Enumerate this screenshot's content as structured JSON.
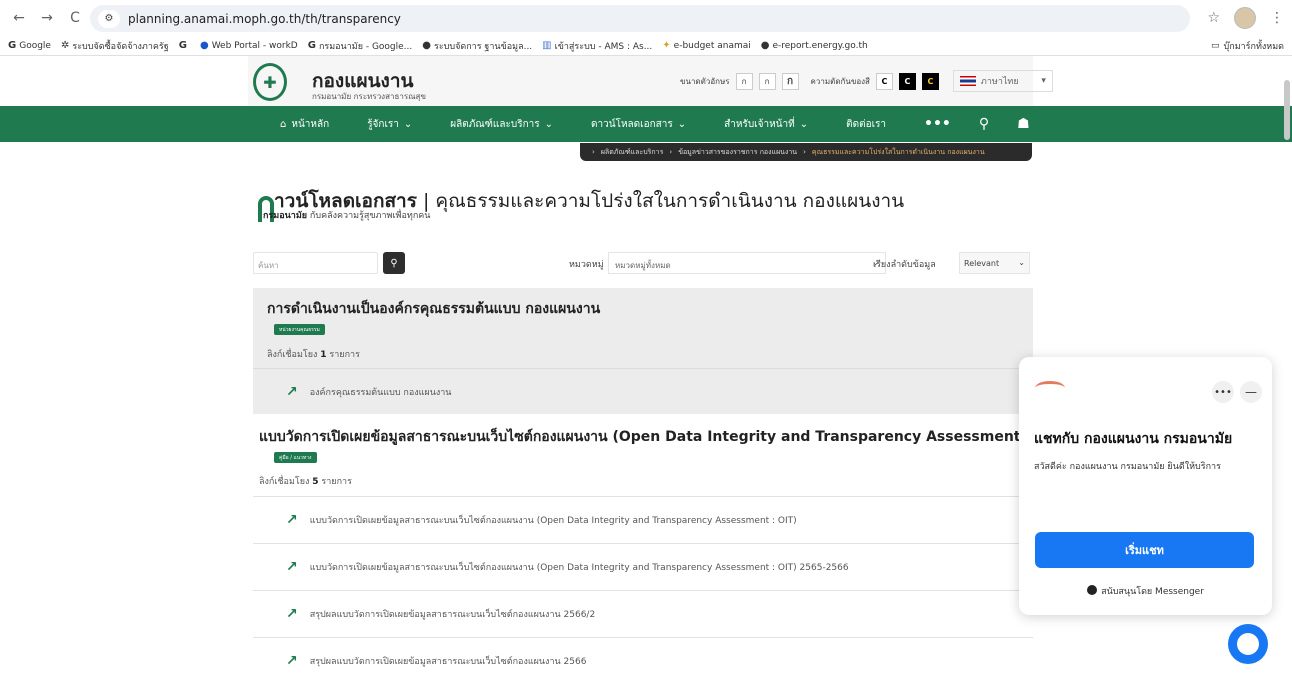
{
  "browser": {
    "url": "planning.anamai.moph.go.th/th/transparency",
    "back": "←",
    "forward": "→",
    "reload": "C",
    "bookmarks": [
      {
        "icon": "G",
        "label": "Google"
      },
      {
        "icon": "✲",
        "label": "ระบบจัดซื้อจัดจ้างภาครัฐ"
      },
      {
        "icon": "G",
        "label": ""
      },
      {
        "icon": "●",
        "label": "Web Portal - workD"
      },
      {
        "icon": "G",
        "label": "กรมอนามัย - Google..."
      },
      {
        "icon": "●",
        "label": "ระบบจัดการ ฐานข้อมูล..."
      },
      {
        "icon": "▥",
        "label": "เข้าสู่ระบบ - AMS : As..."
      },
      {
        "icon": "✦",
        "label": "e-budget anamai"
      },
      {
        "icon": "●",
        "label": "e-report.energy.go.th"
      }
    ],
    "bookmarks_folder": "บุ๊กมาร์กทั้งหมด"
  },
  "site": {
    "name": "กองแผนงาน",
    "subtitle": "กรมอนามัย กระทรวงสาธารณสุข",
    "font_size_label": "ขนาดตัวอักษร",
    "font_buttons": [
      "ก",
      "ก",
      "ก"
    ],
    "contrast_label": "ความตัดกันของสี",
    "contrast_buttons": [
      "C",
      "C",
      "C"
    ],
    "language": "ภาษาไทย",
    "nav": [
      "หน้าหลัก",
      "รู้จักเรา",
      "ผลิตภัณฑ์และบริการ",
      "ดาวน์โหลดเอกสาร",
      "สำหรับเจ้าหน้าที่",
      "ติดต่อเรา",
      "•••"
    ],
    "breadcrumb": [
      "ผลิตภัณฑ์และบริการ",
      "ข้อมูลข่าวสารของราชการ กองแผนงาน",
      "คุณธรรมและความโปร่งใสในการดำเนินงาน กองแผนงาน"
    ]
  },
  "page": {
    "title_main": "าวน์โหลดเอกสาร",
    "title_sep": "|",
    "title_rest": "คุณธรรมและความโปร่งใสในการดำเนินงาน กองแผนงาน",
    "subtitle_bold": "กรมอนามัย",
    "subtitle_rest": "กับคลังความรู้สุขภาพเพื่อทุกคน"
  },
  "filters": {
    "search_placeholder": "ค้นหา",
    "category_label": "หมวดหมู่",
    "category_value": "หมวดหมู่ทั้งหมด",
    "sort_label": "เรียงลำดับข้อมูล",
    "sort_value": "Relevant"
  },
  "groups": [
    {
      "title": "การดำเนินงานเป็นองค์กรคุณธรรมต้นแบบ กองแผนงาน",
      "tag": "หน่วยงานคุณธรรม",
      "count_prefix": "ลิงก์เชื่อมโยง",
      "count": "1",
      "count_suffix": "รายการ",
      "items": [
        "องค์กรคุณธรรมต้นแบบ กองแผนงาน"
      ]
    },
    {
      "title": "แบบวัดการเปิดเผยข้อมูลสาธารณะบนเว็บไซต์กองแผนงาน (Open Data Integrity and Transparency Assessment : OIT)",
      "tag": "คู่มือ / แนวทาง",
      "count_prefix": "ลิงก์เชื่อมโยง",
      "count": "5",
      "count_suffix": "รายการ",
      "items": [
        "แบบวัดการเปิดเผยข้อมูลสาธารณะบนเว็บไซต์กองแผนงาน (Open Data Integrity and Transparency Assessment : OIT)",
        "แบบวัดการเปิดเผยข้อมูลสาธารณะบนเว็บไซต์กองแผนงาน (Open Data Integrity and Transparency Assessment : OIT) 2565-2566",
        "สรุปผลแบบวัดการเปิดเผยข้อมูลสาธารณะบนเว็บไซต์กองแผนงาน 2566/2",
        "สรุปผลแบบวัดการเปิดเผยข้อมูลสาธารณะบนเว็บไซต์กองแผนงาน 2566"
      ]
    }
  ],
  "chat": {
    "title": "แชทกับ กองแผนงาน กรมอนามัย",
    "message": "สวัสดีค่ะ กองแผนงาน กรมอนามัย ยินดีให้บริการ",
    "start_button": "เริ่มแชท",
    "footer": "สนับสนุนโดย Messenger"
  }
}
